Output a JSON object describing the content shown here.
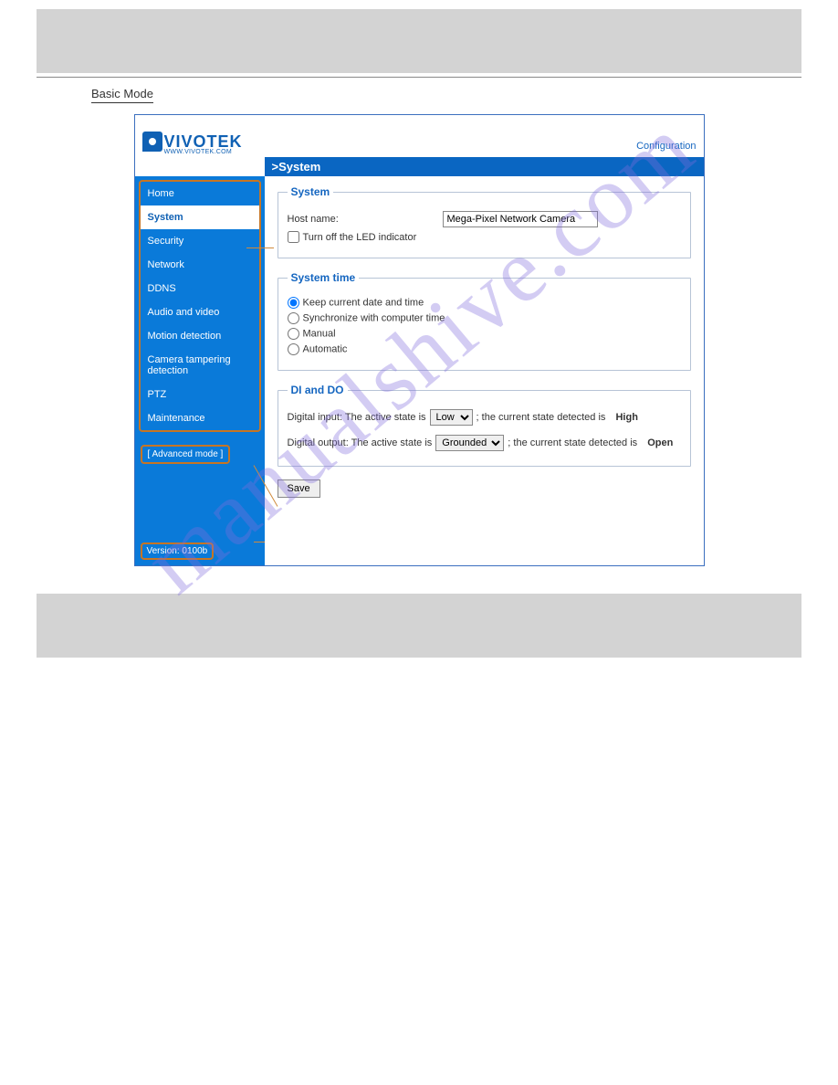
{
  "watermark": "manualshive.com",
  "underline_label": "Basic Mode",
  "ui": {
    "brand": "VIVOTEK",
    "brand_sub": "WWW.VIVOTEK.COM",
    "configuration_link": "Configuration",
    "title": ">System",
    "sidebar": {
      "items": [
        {
          "label": "Home"
        },
        {
          "label": "System"
        },
        {
          "label": "Security"
        },
        {
          "label": "Network"
        },
        {
          "label": "DDNS"
        },
        {
          "label": "Audio and video"
        },
        {
          "label": "Motion detection"
        },
        {
          "label": "Camera tampering detection"
        },
        {
          "label": "PTZ"
        },
        {
          "label": "Maintenance"
        }
      ],
      "advanced": "[ Advanced mode ]",
      "version": "Version: 0100b"
    },
    "panels": {
      "system": {
        "legend": "System",
        "hostname_label": "Host name:",
        "hostname_value": "Mega-Pixel Network Camera",
        "led_label": "Turn off the LED indicator"
      },
      "time": {
        "legend": "System time",
        "opt_keep": "Keep current date and time",
        "opt_sync": "Synchronize with computer time",
        "opt_manual": "Manual",
        "opt_auto": "Automatic"
      },
      "dido": {
        "legend": "DI and DO",
        "di_prefix": "Digital input: The active state is",
        "di_select": "Low",
        "di_mid": "; the current state detected is",
        "di_state": "High",
        "do_prefix": "Digital output: The active state is",
        "do_select": "Grounded",
        "do_mid": "; the current state detected is",
        "do_state": "Open"
      }
    },
    "save_label": "Save"
  }
}
